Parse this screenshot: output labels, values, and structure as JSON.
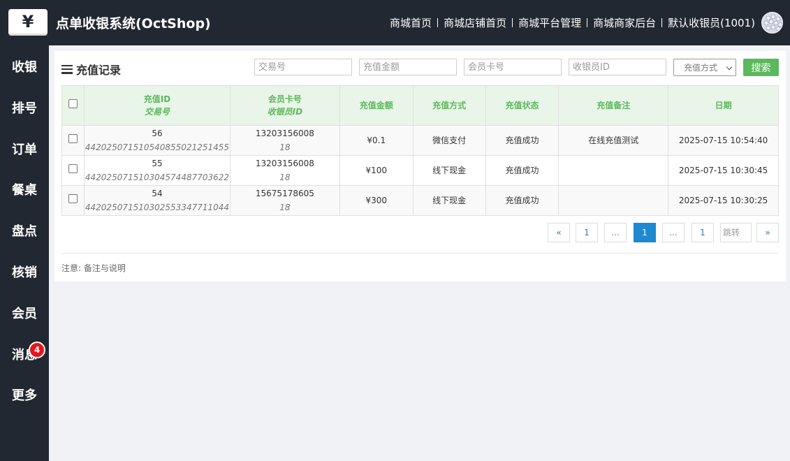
{
  "header": {
    "logo_glyph": "¥",
    "title": "点单收银系统(OctShop)",
    "nav": [
      "商城首页",
      "商城店铺首页",
      "商城平台管理",
      "商城商家后台",
      "默认收银员(1001)"
    ]
  },
  "sidebar": {
    "items": [
      {
        "label": "收银"
      },
      {
        "label": "排号"
      },
      {
        "label": "订单"
      },
      {
        "label": "餐桌"
      },
      {
        "label": "盘点"
      },
      {
        "label": "核销"
      },
      {
        "label": "会员"
      },
      {
        "label": "消息",
        "badge": "4"
      },
      {
        "label": "更多"
      }
    ]
  },
  "panel": {
    "title": "充值记录",
    "filters": {
      "trade_no_placeholder": "交易号",
      "amount_placeholder": "充值金额",
      "card_placeholder": "会员卡号",
      "cashier_placeholder": "收银员ID",
      "method_selected": "充值方式",
      "search_label": "搜索"
    },
    "table": {
      "headers": [
        {
          "main": "充值ID",
          "sub": "交易号"
        },
        {
          "main": "会员卡号",
          "sub": "收银员ID"
        },
        {
          "main": "充值金额"
        },
        {
          "main": "充值方式"
        },
        {
          "main": "充值状态"
        },
        {
          "main": "充值备注"
        },
        {
          "main": "日期"
        }
      ],
      "rows": [
        {
          "id": "56",
          "trade_no": "4420250715105408550212514​55",
          "card": "13203156008",
          "cashier": "18",
          "amount": "¥0.1",
          "method": "微信支付",
          "status": "充值成功",
          "remark": "在线充值测试",
          "date": "2025-07-15 10:54:40"
        },
        {
          "id": "55",
          "trade_no": "442025071510304574487703622",
          "card": "13203156008",
          "cashier": "18",
          "amount": "¥100",
          "method": "线下现金",
          "status": "充值成功",
          "remark": "",
          "date": "2025-07-15 10:30:45"
        },
        {
          "id": "54",
          "trade_no": "442025071510302553347711044",
          "card": "15675178605",
          "cashier": "18",
          "amount": "¥300",
          "method": "线下现金",
          "status": "充值成功",
          "remark": "",
          "date": "2025-07-15 10:30:25"
        }
      ]
    },
    "pagination": {
      "first": "«",
      "p1": "1",
      "dots1": "...",
      "current": "1",
      "dots2": "...",
      "p_last": "1",
      "jump_placeholder": "跳转",
      "last": "»"
    },
    "note": "注意: 备注与说明"
  },
  "colors": {
    "dark": "#222831",
    "green": "#5cb85c",
    "blue": "#1e88d0",
    "badge": "#e8141a"
  }
}
